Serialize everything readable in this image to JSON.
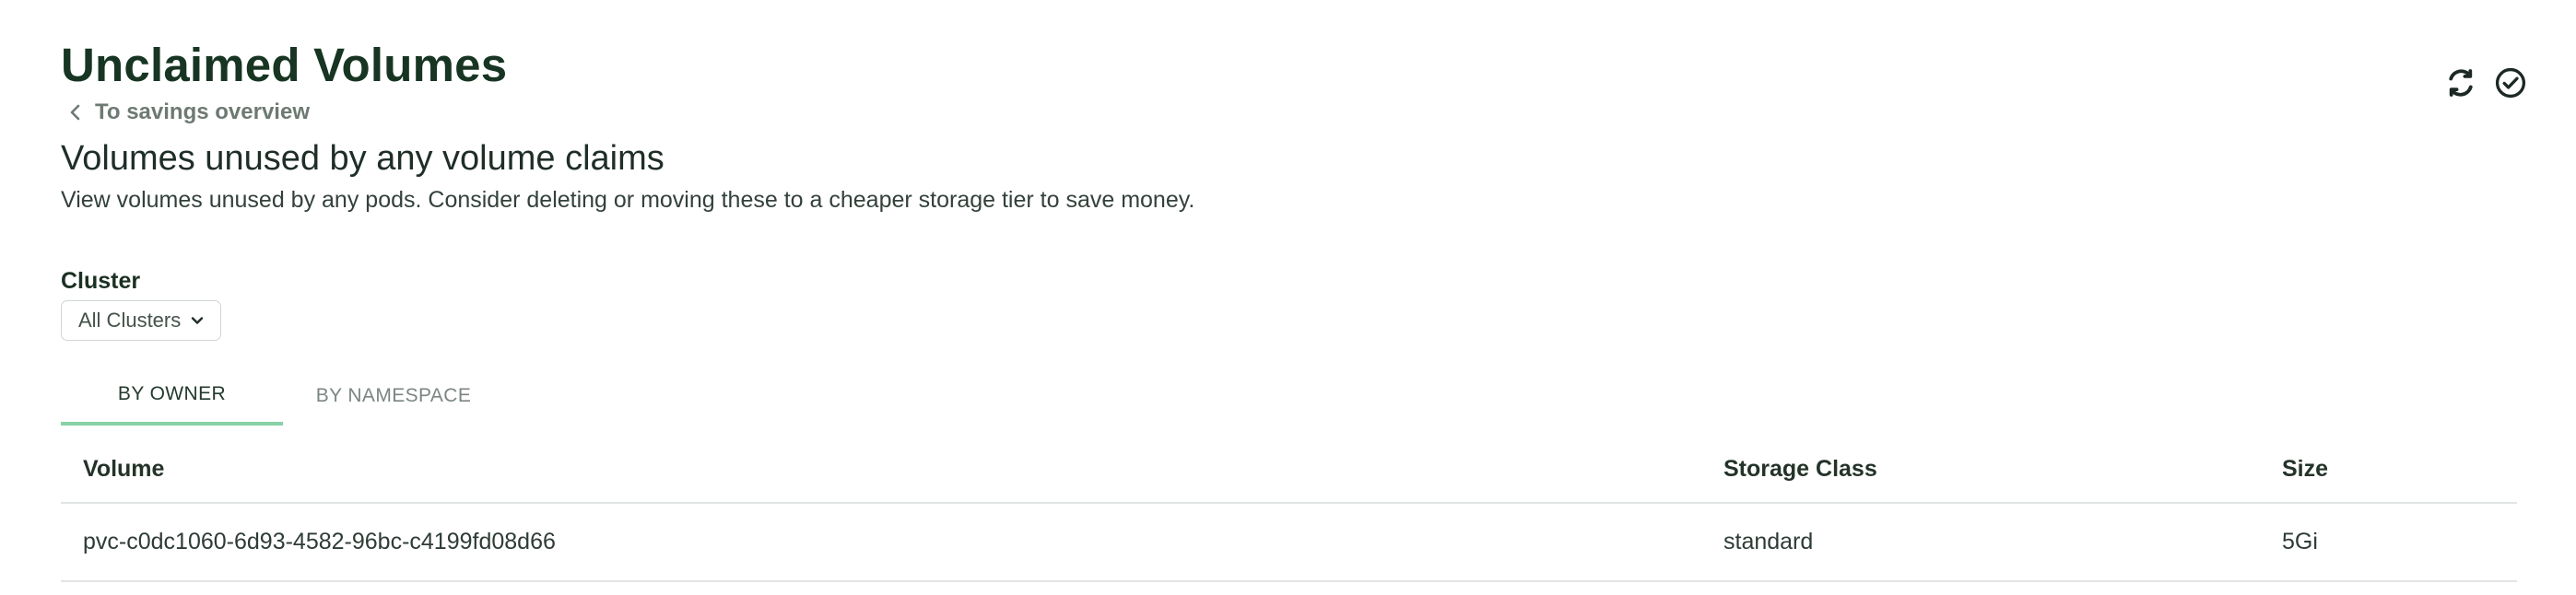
{
  "header": {
    "title": "Unclaimed Volumes",
    "back_link_label": "To savings overview",
    "subtitle": "Volumes unused by any volume claims",
    "description": "View volumes unused by any pods. Consider deleting or moving these to a cheaper storage tier to save money.",
    "actions": [
      {
        "icon": "refresh-icon"
      },
      {
        "icon": "check-circle-icon"
      }
    ]
  },
  "filters": {
    "cluster": {
      "label": "Cluster",
      "selected": "All Clusters"
    }
  },
  "tabs": [
    {
      "label": "BY OWNER",
      "active": true
    },
    {
      "label": "BY NAMESPACE",
      "active": false
    }
  ],
  "table": {
    "columns": [
      "Volume",
      "Storage Class",
      "Size"
    ],
    "rows": [
      [
        "pvc-c0dc1060-6d93-4582-96bc-c4199fd08d66",
        "standard",
        "5Gi"
      ]
    ]
  },
  "colors": {
    "title": "#173522",
    "active_tab_indicator": "#86d1a6",
    "border": "#e1e5e3"
  }
}
